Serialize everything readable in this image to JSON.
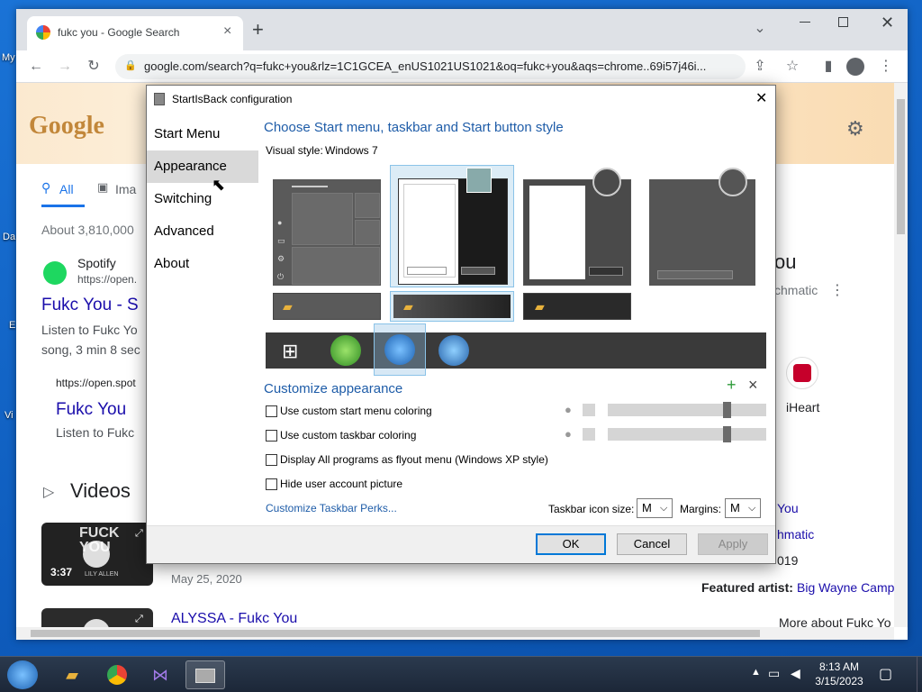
{
  "desktop": {
    "icon_labels": [
      "My",
      "Da",
      "E",
      "Vi"
    ]
  },
  "chrome": {
    "tab_title": "fukc you - Google Search",
    "new_tab_symbol": "+",
    "url": "google.com/search?q=fukc+you&rlz=1C1GCEA_enUS1021US1021&oq=fukc+you&aqs=chrome..69i57j46i...",
    "window_controls": [
      "chevron-down-icon",
      "minimize-icon",
      "maximize-icon",
      "close-icon"
    ]
  },
  "page": {
    "logo_text": "Google",
    "tab_all": "All",
    "tab_images": "Ima",
    "result_count": "About 3,810,000",
    "spotify_name": "Spotify",
    "spotify_url": "https://open.",
    "result1_title": "Fukc You - S",
    "result1_snippet_line1": "Listen to Fukc Yo",
    "result1_snippet_line2": "song, 3 min 8 sec",
    "result2_url": "https://open.spot",
    "result2_title": "Fukc You",
    "result2_snippet": "Listen to Fukc",
    "videos_heading": "Videos",
    "video_duration": "3:37",
    "video_thumb_text": "FUCK YOU",
    "video_thumb_sub": "LILY ALLEN",
    "video_date": "May 25, 2020",
    "video2_title": "ALYSSA - Fukc You",
    "kp_title_frag": "ou",
    "kp_artist_frag": "chmatic",
    "iheart_label": "iHeart",
    "kp_song_link": "You",
    "kp_artist_link": "hmatic",
    "kp_year": "019",
    "featured_label": "Featured artist:",
    "featured_value": "Big Wayne Camp",
    "more_about": "More about Fukc Yo"
  },
  "dialog": {
    "title": "StartIsBack configuration",
    "nav": [
      "Start Menu",
      "Appearance",
      "Switching",
      "Advanced",
      "About"
    ],
    "selected_nav": "Appearance",
    "heading": "Choose Start menu, taskbar and Start button style",
    "visual_style_label": "Visual style:",
    "visual_style_value": "Windows 7",
    "customize_heading": "Customize appearance",
    "options": [
      {
        "label": "Use custom start menu coloring",
        "checked": false
      },
      {
        "label": "Use custom taskbar coloring",
        "checked": false
      },
      {
        "label": "Display All programs as flyout menu (Windows XP style)",
        "checked": false
      },
      {
        "label": "Hide user account picture",
        "checked": false
      }
    ],
    "perks_link": "Customize Taskbar Perks...",
    "taskbar_icon_size_label": "Taskbar icon size:",
    "taskbar_icon_size_value": "M",
    "margins_label": "Margins:",
    "margins_value": "M",
    "add_symbol": "+",
    "remove_symbol": "×",
    "buttons": {
      "ok": "OK",
      "cancel": "Cancel",
      "apply": "Apply"
    }
  },
  "taskbar": {
    "time": "8:13 AM",
    "date": "3/15/2023"
  }
}
